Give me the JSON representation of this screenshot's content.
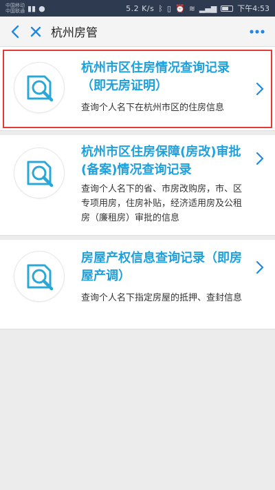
{
  "status_bar": {
    "carrier_line1": "中国移动",
    "carrier_line2": "中国联通",
    "network_speed": "5.2 K/s",
    "time": "下午4:53",
    "bg_color": "#2d3a4f"
  },
  "nav": {
    "title": "杭州房管",
    "back_icon": "chevron-left-icon",
    "close_icon": "close-icon",
    "more_icon": "more-icon",
    "accent_color": "#1e88e5"
  },
  "items": [
    {
      "title": "杭州市区住房情况查询记录（即无房证明）",
      "description": "查询个人名下在杭州市区的住房信息",
      "icon": "magnifier-document-icon",
      "highlighted": true
    },
    {
      "title": "杭州市区住房保障(房改)审批(备案)情况查询记录",
      "description": "查询个人名下的省、市房改购房，市、区专项用房，住房补贴，经济适用房及公租房（廉租房）审批的信息",
      "icon": "magnifier-document-icon",
      "highlighted": false
    },
    {
      "title": "房屋产权信息查询记录（即房屋产调）",
      "description": "查询个人名下指定房屋的抵押、查封信息",
      "icon": "magnifier-document-icon",
      "highlighted": false
    }
  ],
  "colors": {
    "title_color": "#1ea0dc",
    "highlight_border": "#e53935",
    "background": "#ececec"
  }
}
